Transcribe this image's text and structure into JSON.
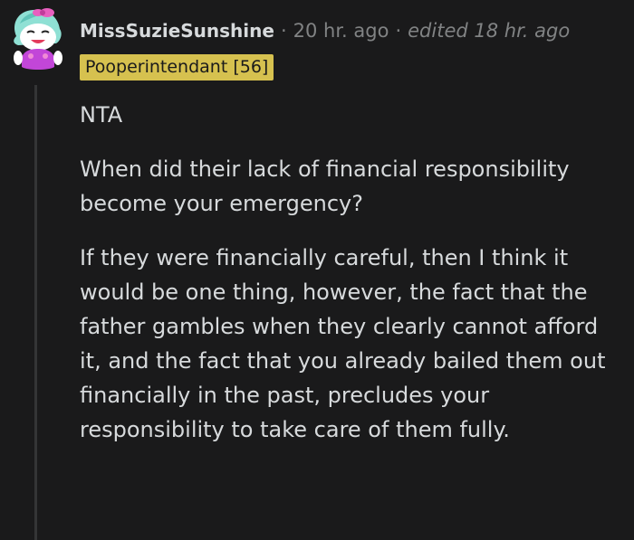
{
  "comment": {
    "author": "MissSuzieSunshine",
    "separator": "·",
    "time": "20 hr. ago",
    "edited": "edited 18 hr. ago",
    "flair": "Pooperintendant [56]",
    "paragraphs": [
      "NTA",
      "When did their lack of financial responsibility become your emergency?",
      "If they were financially careful, then I think it would be one thing, however, the fact that the father gambles when they clearly cannot afford it, and the fact that you already bailed them out financially in the past, precludes your responsibility to take care of them fully."
    ]
  },
  "colors": {
    "background": "#1a1a1b",
    "text": "#d7dadc",
    "muted": "#818384",
    "flair_bg": "#d6c14f",
    "thread_line": "#343536"
  }
}
